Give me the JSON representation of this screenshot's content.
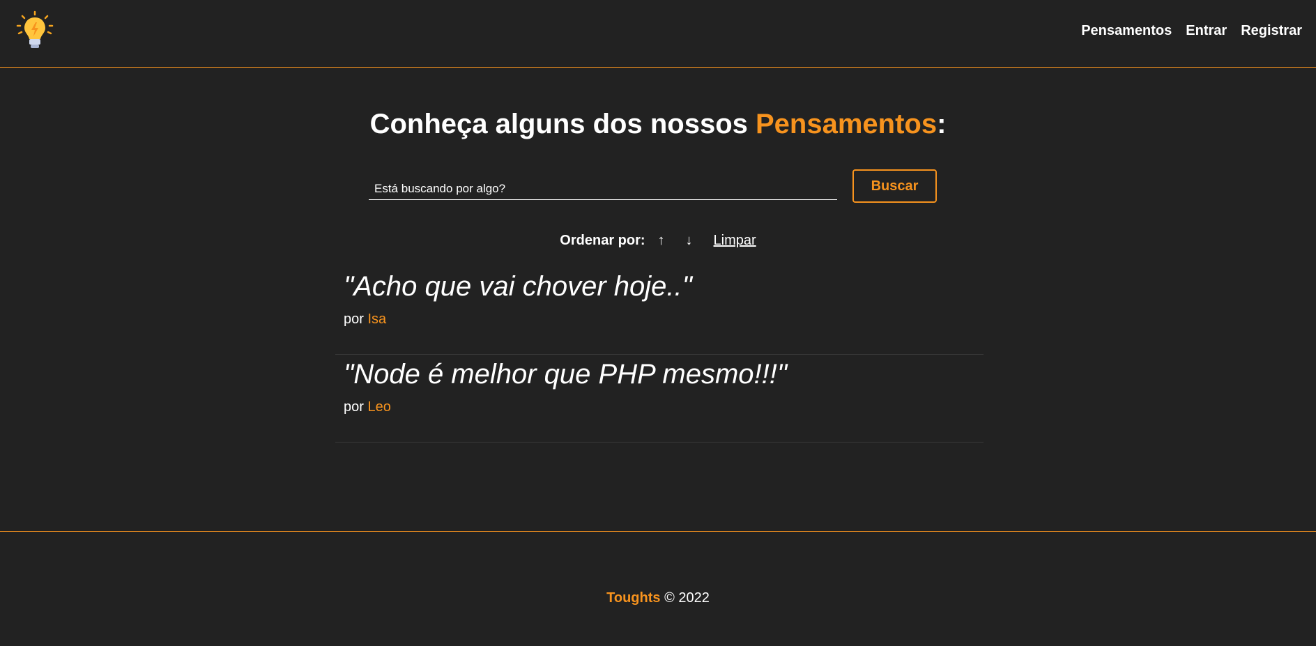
{
  "navbar": {
    "logo_icon": "lightbulb-icon",
    "links": [
      "Pensamentos",
      "Entrar",
      "Registrar"
    ]
  },
  "main": {
    "title_prefix": "Conheça alguns dos nossos ",
    "title_highlight": "Pensamentos",
    "title_suffix": ":",
    "search": {
      "placeholder": "Está buscando por algo?",
      "value": "",
      "button_label": "Buscar"
    },
    "order": {
      "label": "Ordenar por:",
      "asc_icon": "↑",
      "desc_icon": "↓",
      "clear_label": "Limpar"
    },
    "thoughts": [
      {
        "text": "\"Acho que vai chover hoje..\"",
        "by": "por",
        "author": "Isa"
      },
      {
        "text": "\"Node é melhor que PHP mesmo!!!\"",
        "by": "por",
        "author": "Leo"
      }
    ]
  },
  "footer": {
    "brand": "Toughts",
    "copyright": "© 2022"
  },
  "colors": {
    "background": "#222222",
    "accent": "#f7931e",
    "text": "#ffffff"
  }
}
